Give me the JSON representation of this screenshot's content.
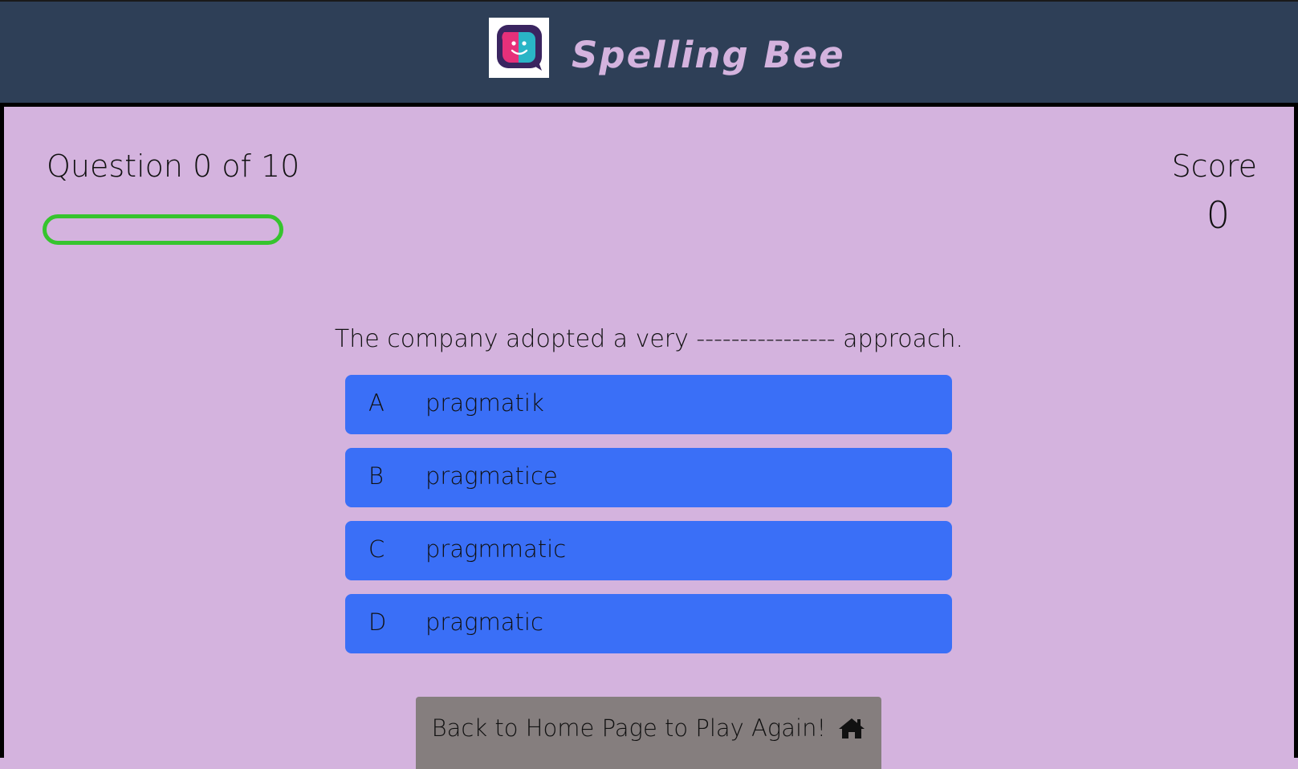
{
  "header": {
    "title": "Spelling Bee",
    "logo_icon": "chat-face-icon"
  },
  "quiz": {
    "question_counter": "Question 0 of 10",
    "progress_fraction": 0,
    "score_label": "Score",
    "score_value": "0",
    "question_text": "The company adopted a very ---------------- approach.",
    "choices": [
      {
        "letter": "A",
        "text": "pragmatik"
      },
      {
        "letter": "B",
        "text": "pragmatice"
      },
      {
        "letter": "C",
        "text": "pragmmatic"
      },
      {
        "letter": "D",
        "text": "pragmatic"
      }
    ],
    "home_button_label": "Back to Home Page to Play Again!",
    "home_button_icon": "home-icon"
  },
  "colors": {
    "header_bg": "#2e3f57",
    "page_bg": "#d4b3de",
    "title": "#d4b3de",
    "progress": "#36c42e",
    "choice_bg": "#3a6ff7",
    "home_button_bg": "#857e7e"
  }
}
